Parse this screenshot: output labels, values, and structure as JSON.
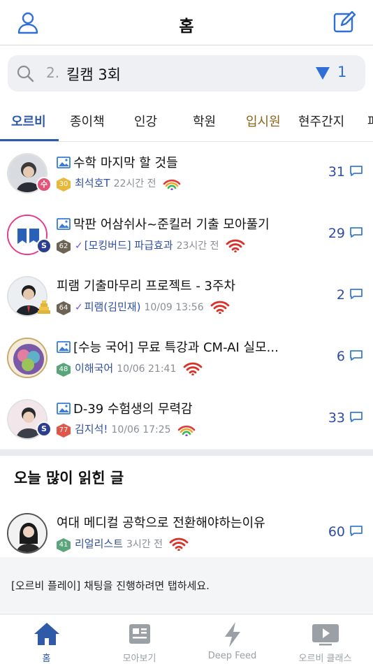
{
  "header": {
    "title": "홈",
    "left_icon": "user-icon",
    "right_icon": "compose-icon"
  },
  "search": {
    "prefix": "2.",
    "query": "킬캠 3회",
    "filter_count": "1",
    "icon": "search-icon",
    "filter_icon": "filter-icon"
  },
  "tabs": [
    "오르비",
    "종이책",
    "인강",
    "학원",
    "입시원",
    "현주간지",
    "파"
  ],
  "posts": [
    {
      "title": "수학 마지막 할 것들",
      "has_image": true,
      "level": "30",
      "author": "최석호T",
      "time": "22시간 전",
      "comments": "31",
      "badge": "수",
      "signal": "rainbow"
    },
    {
      "title": "막판 어삼쉬사~준킬러 기출 모아풀기",
      "has_image": true,
      "level": "62",
      "author": "[모킹버드] 파급효과",
      "time": "23시간 전",
      "comments": "29",
      "badge": "S",
      "signal": "red"
    },
    {
      "title": "피램 기출마무리 프로젝트 - 3주차",
      "has_image": false,
      "level": "64",
      "author": "피램(김민재)",
      "time": "10/09 13:56",
      "comments": "2",
      "badge": "",
      "signal": "red"
    },
    {
      "title": "[수능 국어] 무료 특강과 CM-AI 실모...",
      "has_image": true,
      "level": "48",
      "author": "이해국어",
      "time": "10/06 21:41",
      "comments": "6",
      "badge": "",
      "signal": "red"
    },
    {
      "title": "D-39 수험생의 무력감",
      "has_image": true,
      "level": "77",
      "author": "김지석!",
      "time": "10/06 17:25",
      "comments": "33",
      "badge": "S",
      "signal": "rainbow"
    }
  ],
  "popular": {
    "section_title": "오늘 많이 읽힌 글",
    "post": {
      "title": "여대 메디컬 공학으로 전환해야하는이유",
      "level": "41",
      "author": "리얼리스트",
      "time": "3시간 전",
      "comments": "60",
      "signal": "red"
    }
  },
  "banner": {
    "text": "[오르비 플레이] 채팅을 진행하려면 탭하세요."
  },
  "bottom_nav": [
    {
      "label": "홈",
      "icon": "home-icon"
    },
    {
      "label": "모아보기",
      "icon": "news-icon"
    },
    {
      "label": "Deep Feed",
      "icon": "lightning-icon"
    },
    {
      "label": "오르비 클래스",
      "icon": "play-icon"
    }
  ],
  "colors": {
    "accent": "#2f5aa8",
    "author": "#2f4ea0",
    "signal_red": "#d9322a",
    "gold_tab": "#8a6418"
  }
}
